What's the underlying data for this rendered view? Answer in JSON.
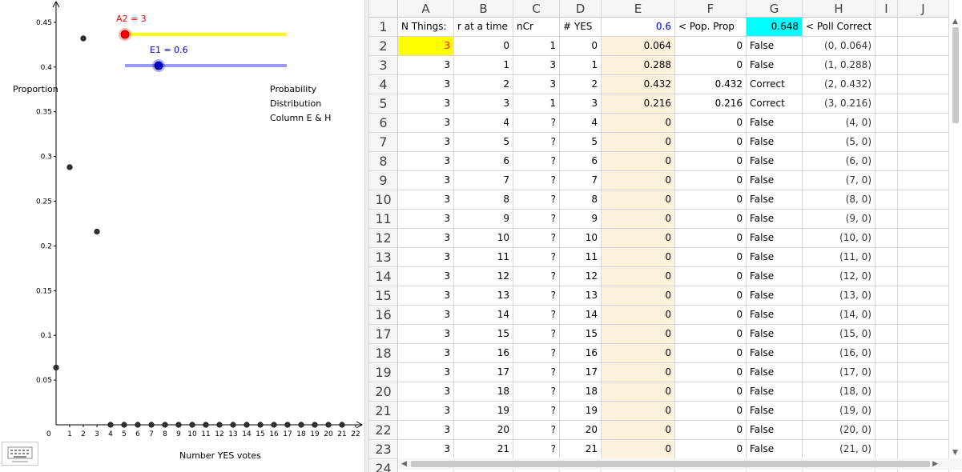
{
  "graph": {
    "y_axis_label": "Proportion",
    "x_axis_label": "Number YES votes",
    "origin_label": "0",
    "annotation_lines": [
      "Probability",
      "Distribution",
      "Column E & H"
    ],
    "slider_a2": {
      "label": "A2 = 3",
      "value": 3,
      "color": "#ff0000",
      "track_color": "#ffff00"
    },
    "slider_e1": {
      "label": "E1 = 0.6",
      "value": 0.6,
      "color": "#0000cc",
      "track_color": "#9999ff"
    },
    "keyboard_icon": "keyboard-icon"
  },
  "chart_data": {
    "type": "scatter",
    "title": "",
    "xlabel": "Number YES votes",
    "ylabel": "Proportion",
    "xlim": [
      0,
      22
    ],
    "ylim": [
      0,
      0.45
    ],
    "x_ticks": [
      "1",
      "2",
      "3",
      "4",
      "5",
      "6",
      "7",
      "8",
      "9",
      "10",
      "11",
      "12",
      "13",
      "14",
      "15",
      "16",
      "17",
      "18",
      "19",
      "20",
      "21",
      "22"
    ],
    "y_ticks": [
      "0.05",
      "0.1",
      "0.15",
      "0.2",
      "0.25",
      "0.3",
      "0.35",
      "0.4",
      "0.45"
    ],
    "points": [
      {
        "x": 0,
        "y": 0.064
      },
      {
        "x": 1,
        "y": 0.288
      },
      {
        "x": 2,
        "y": 0.432
      },
      {
        "x": 3,
        "y": 0.216
      },
      {
        "x": 4,
        "y": 0
      },
      {
        "x": 5,
        "y": 0
      },
      {
        "x": 6,
        "y": 0
      },
      {
        "x": 7,
        "y": 0
      },
      {
        "x": 8,
        "y": 0
      },
      {
        "x": 9,
        "y": 0
      },
      {
        "x": 10,
        "y": 0
      },
      {
        "x": 11,
        "y": 0
      },
      {
        "x": 12,
        "y": 0
      },
      {
        "x": 13,
        "y": 0
      },
      {
        "x": 14,
        "y": 0
      },
      {
        "x": 15,
        "y": 0
      },
      {
        "x": 16,
        "y": 0
      },
      {
        "x": 17,
        "y": 0
      },
      {
        "x": 18,
        "y": 0
      },
      {
        "x": 19,
        "y": 0
      },
      {
        "x": 20,
        "y": 0
      },
      {
        "x": 21,
        "y": 0
      }
    ],
    "grid": false
  },
  "sheet": {
    "columns": [
      "A",
      "B",
      "C",
      "D",
      "E",
      "F",
      "G",
      "H",
      "I",
      "J"
    ],
    "rows": [
      {
        "n": "1",
        "A": "N Things:",
        "B": "r at a time",
        "C": "nCr",
        "D": "# YES",
        "E": "0.6",
        "F": "< Pop. Prop",
        "G": "0.648",
        "H": "< Poll Correct"
      },
      {
        "n": "2",
        "A": "3",
        "B": "0",
        "C": "1",
        "D": "0",
        "E": "0.064",
        "F": "0",
        "G": "False",
        "H": "(0, 0.064)"
      },
      {
        "n": "3",
        "A": "3",
        "B": "1",
        "C": "3",
        "D": "1",
        "E": "0.288",
        "F": "0",
        "G": "False",
        "H": "(1, 0.288)"
      },
      {
        "n": "4",
        "A": "3",
        "B": "2",
        "C": "3",
        "D": "2",
        "E": "0.432",
        "F": "0.432",
        "G": "Correct",
        "H": "(2, 0.432)"
      },
      {
        "n": "5",
        "A": "3",
        "B": "3",
        "C": "1",
        "D": "3",
        "E": "0.216",
        "F": "0.216",
        "G": "Correct",
        "H": "(3, 0.216)"
      },
      {
        "n": "6",
        "A": "3",
        "B": "4",
        "C": "?",
        "D": "4",
        "E": "0",
        "F": "0",
        "G": "False",
        "H": "(4, 0)"
      },
      {
        "n": "7",
        "A": "3",
        "B": "5",
        "C": "?",
        "D": "5",
        "E": "0",
        "F": "0",
        "G": "False",
        "H": "(5, 0)"
      },
      {
        "n": "8",
        "A": "3",
        "B": "6",
        "C": "?",
        "D": "6",
        "E": "0",
        "F": "0",
        "G": "False",
        "H": "(6, 0)"
      },
      {
        "n": "9",
        "A": "3",
        "B": "7",
        "C": "?",
        "D": "7",
        "E": "0",
        "F": "0",
        "G": "False",
        "H": "(7, 0)"
      },
      {
        "n": "10",
        "A": "3",
        "B": "8",
        "C": "?",
        "D": "8",
        "E": "0",
        "F": "0",
        "G": "False",
        "H": "(8, 0)"
      },
      {
        "n": "11",
        "A": "3",
        "B": "9",
        "C": "?",
        "D": "9",
        "E": "0",
        "F": "0",
        "G": "False",
        "H": "(9, 0)"
      },
      {
        "n": "12",
        "A": "3",
        "B": "10",
        "C": "?",
        "D": "10",
        "E": "0",
        "F": "0",
        "G": "False",
        "H": "(10, 0)"
      },
      {
        "n": "13",
        "A": "3",
        "B": "11",
        "C": "?",
        "D": "11",
        "E": "0",
        "F": "0",
        "G": "False",
        "H": "(11, 0)"
      },
      {
        "n": "14",
        "A": "3",
        "B": "12",
        "C": "?",
        "D": "12",
        "E": "0",
        "F": "0",
        "G": "False",
        "H": "(12, 0)"
      },
      {
        "n": "15",
        "A": "3",
        "B": "13",
        "C": "?",
        "D": "13",
        "E": "0",
        "F": "0",
        "G": "False",
        "H": "(13, 0)"
      },
      {
        "n": "16",
        "A": "3",
        "B": "14",
        "C": "?",
        "D": "14",
        "E": "0",
        "F": "0",
        "G": "False",
        "H": "(14, 0)"
      },
      {
        "n": "17",
        "A": "3",
        "B": "15",
        "C": "?",
        "D": "15",
        "E": "0",
        "F": "0",
        "G": "False",
        "H": "(15, 0)"
      },
      {
        "n": "18",
        "A": "3",
        "B": "16",
        "C": "?",
        "D": "16",
        "E": "0",
        "F": "0",
        "G": "False",
        "H": "(16, 0)"
      },
      {
        "n": "19",
        "A": "3",
        "B": "17",
        "C": "?",
        "D": "17",
        "E": "0",
        "F": "0",
        "G": "False",
        "H": "(17, 0)"
      },
      {
        "n": "20",
        "A": "3",
        "B": "18",
        "C": "?",
        "D": "18",
        "E": "0",
        "F": "0",
        "G": "False",
        "H": "(18, 0)"
      },
      {
        "n": "21",
        "A": "3",
        "B": "19",
        "C": "?",
        "D": "19",
        "E": "0",
        "F": "0",
        "G": "False",
        "H": "(19, 0)"
      },
      {
        "n": "22",
        "A": "3",
        "B": "20",
        "C": "?",
        "D": "20",
        "E": "0",
        "F": "0",
        "G": "False",
        "H": "(20, 0)"
      },
      {
        "n": "23",
        "A": "3",
        "B": "21",
        "C": "?",
        "D": "21",
        "E": "0",
        "F": "0",
        "G": "False",
        "H": "(21, 0)"
      },
      {
        "n": "24",
        "A": "",
        "B": "",
        "C": "",
        "D": "",
        "E": "",
        "F": "",
        "G": "",
        "H": ""
      }
    ],
    "colors": {
      "a2_highlight": "#ffff00",
      "a2_text": "#ff0000",
      "e_column": "#fff2dc",
      "e1_text": "#0000cc",
      "g1_highlight": "#00ffff"
    }
  }
}
